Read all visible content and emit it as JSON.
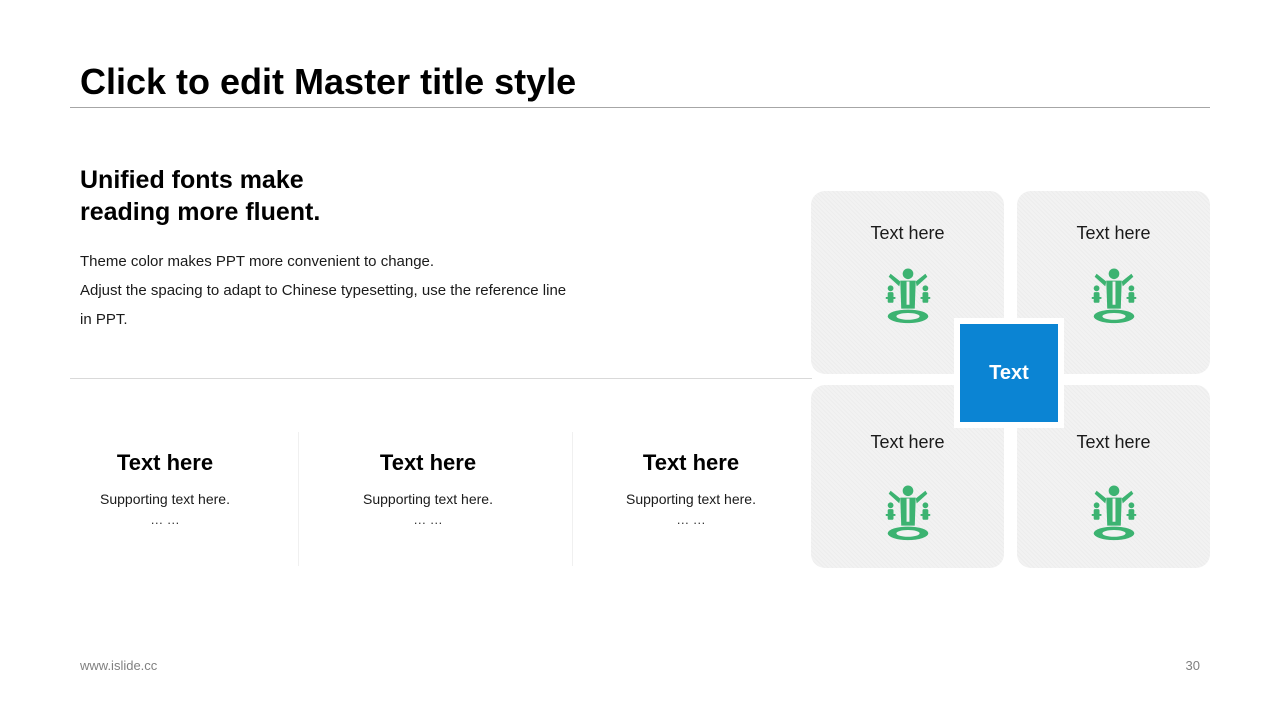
{
  "slide": {
    "title": "Click to edit Master title style",
    "headline": [
      "Unified fonts make",
      "reading more fluent."
    ],
    "body_lines": [
      "Theme color makes PPT more convenient to change.",
      "Adjust the spacing to adapt to Chinese typesetting, use the reference line",
      "in PPT."
    ],
    "columns": [
      {
        "title": "Text here",
        "sub": "Supporting  text here.",
        "dots": "… …"
      },
      {
        "title": "Text here",
        "sub": "Supporting  text here.",
        "dots": "… …"
      },
      {
        "title": "Text here",
        "sub": "Supporting  text here.",
        "dots": "… …"
      }
    ],
    "cards": [
      {
        "label": "Text here",
        "icon": "balance-person-icon"
      },
      {
        "label": "Text here",
        "icon": "balance-person-icon"
      },
      {
        "label": "Text here",
        "icon": "balance-person-icon"
      },
      {
        "label": "Text here",
        "icon": "balance-person-icon"
      }
    ],
    "center_label": "Text",
    "footer_url": "www.islide.cc",
    "page_number": "30"
  },
  "colors": {
    "accent_blue": "#0b84d3",
    "icon_green": "#3cb371",
    "card_bg": "#f2f2f2"
  }
}
